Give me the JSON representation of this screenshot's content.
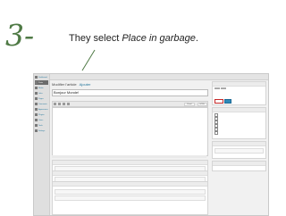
{
  "slide": {
    "step_number": "3-",
    "instruction_prefix": "They select ",
    "instruction_emphasis": "Place in garbage",
    "instruction_suffix": ".",
    "accent_color": "#4f7a45",
    "highlight_color": "#c62828"
  },
  "screenshot": {
    "sidebar_items": [
      {
        "icon": "dashboard-icon",
        "label": "Dashboard",
        "active": false
      },
      {
        "icon": "posts-icon",
        "label": "Posts",
        "active": true
      },
      {
        "icon": "media-icon",
        "label": "Media",
        "active": false
      },
      {
        "icon": "links-icon",
        "label": "Links",
        "active": false
      },
      {
        "icon": "pages-icon",
        "label": "Pages",
        "active": false
      },
      {
        "icon": "comments-icon",
        "label": "Comments",
        "active": false
      },
      {
        "icon": "appearance-icon",
        "label": "Appearance",
        "active": false
      },
      {
        "icon": "plugins-icon",
        "label": "Plugins",
        "active": false
      },
      {
        "icon": "users-icon",
        "label": "Users",
        "active": false
      },
      {
        "icon": "tools-icon",
        "label": "Tools",
        "active": false
      },
      {
        "icon": "settings-icon",
        "label": "Settings",
        "active": false
      }
    ],
    "page_title": "Modifier l'article",
    "add_new": "Ajouter",
    "post_title": "Bonjour Monde!",
    "editor_tabs": [
      "Visuel",
      "HTML"
    ]
  }
}
